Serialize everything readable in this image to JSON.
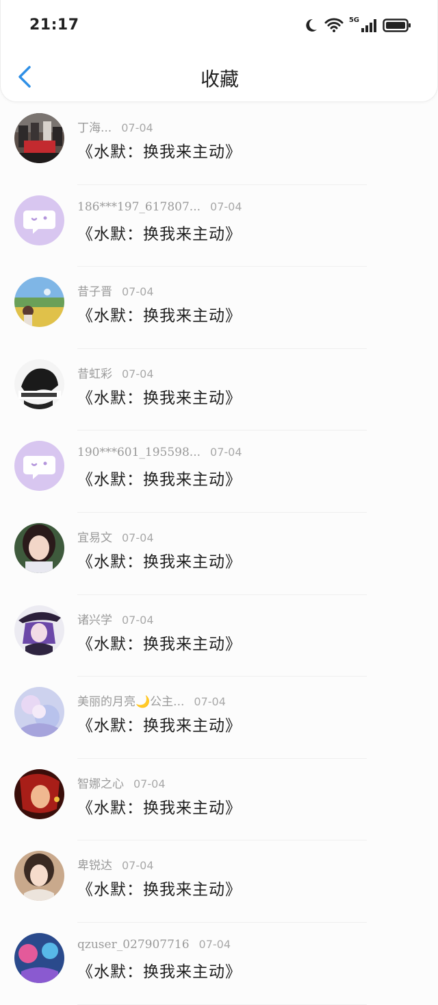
{
  "status_bar": {
    "time": "21:17",
    "network": "5G"
  },
  "header": {
    "title": "收藏",
    "back_icon": "chevron-left-icon",
    "accent": "#2e8fe6"
  },
  "items": [
    {
      "name": "丁海...",
      "date": "07-04",
      "content": "《水默：换我来主动》",
      "avatar": "photo-group"
    },
    {
      "name": "186***197_617807...",
      "date": "07-04",
      "content": "《水默：换我来主动》",
      "avatar": "default-chat"
    },
    {
      "name": "昔子晋",
      "date": "07-04",
      "content": "《水默：换我来主动》",
      "avatar": "landscape"
    },
    {
      "name": "昔虹彩",
      "date": "07-04",
      "content": "《水默：换我来主动》",
      "avatar": "mono-text"
    },
    {
      "name": "190***601_195598...",
      "date": "07-04",
      "content": "《水默：换我来主动》",
      "avatar": "default-chat"
    },
    {
      "name": "宜易文",
      "date": "07-04",
      "content": "《水默：换我来主动》",
      "avatar": "portrait"
    },
    {
      "name": "诸兴学",
      "date": "07-04",
      "content": "《水默：换我来主动》",
      "avatar": "anime-purple"
    },
    {
      "name": "美丽的月亮🌙公主...",
      "date": "07-04",
      "content": "《水默：换我来主动》",
      "avatar": "anime-pastel"
    },
    {
      "name": "智娜之心",
      "date": "07-04",
      "content": "《水默：换我来主动》",
      "avatar": "anime-red"
    },
    {
      "name": "卑锐达",
      "date": "07-04",
      "content": "《水默：换我来主动》",
      "avatar": "portrait-girl"
    },
    {
      "name": "qzuser_027907716",
      "date": "07-04",
      "content": "《水默：换我来主动》",
      "avatar": "anime-blue"
    }
  ]
}
